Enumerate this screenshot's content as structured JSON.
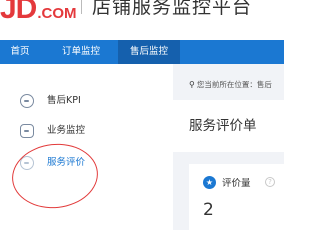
{
  "header": {
    "logo_main": "JD",
    "logo_suffix": ".COM",
    "app_title": "店铺服务监控平台"
  },
  "nav": {
    "items": [
      {
        "label": "首页",
        "active": false
      },
      {
        "label": "订单监控",
        "active": false
      },
      {
        "label": "售后监控",
        "active": true
      }
    ]
  },
  "sidebar": {
    "items": [
      {
        "label": "售后KPI",
        "icon": "kpi-icon"
      },
      {
        "label": "业务监控",
        "icon": "monitor-icon"
      },
      {
        "label": "服务评价",
        "icon": "review-icon",
        "active": true
      }
    ]
  },
  "main": {
    "breadcrumb_prefix": "您当前所在位置：",
    "breadcrumb_current": "售后",
    "page_title": "服务评价单",
    "card": {
      "icon": "star-badge-icon",
      "label": "评价量",
      "value": "2"
    }
  },
  "colors": {
    "brand_red": "#e4393c",
    "nav_blue": "#1b78d2",
    "nav_active": "#1560ad",
    "highlight": "#e23a3a"
  }
}
